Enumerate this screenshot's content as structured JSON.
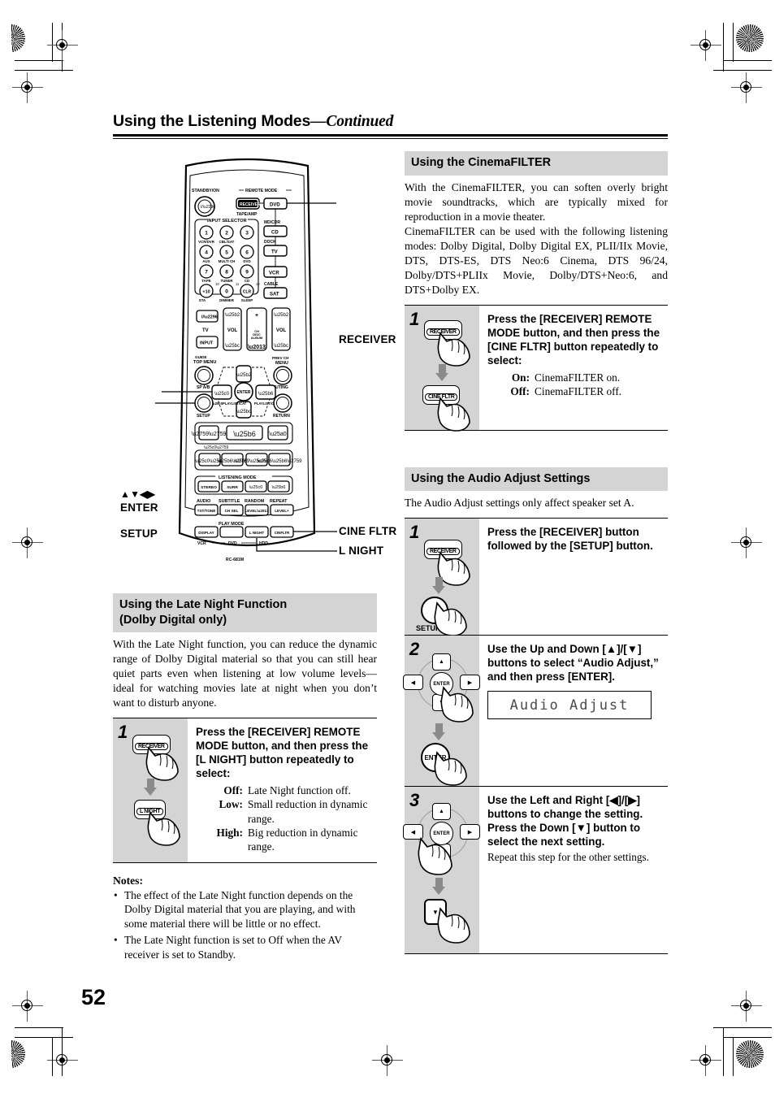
{
  "page": {
    "running_head_main": "Using the Listening Modes",
    "running_head_cont": "—Continued",
    "page_number": "52"
  },
  "remote": {
    "model": "RC-681M",
    "labels": {
      "standby": "STANDBY/ON",
      "remote_mode": "REMOTE MODE",
      "input_selector": "INPUT SELECTOR",
      "listening_mode": "LISTENING MODE",
      "play_mode": "PLAY MODE",
      "top_menu": "TOP MENU",
      "guide": "GUIDE",
      "menu": "MENU",
      "prev_ch": "PREV CH",
      "setup": "SETUP",
      "return": "RETURN",
      "muting": "MUTING",
      "sp_ab": "SP A/B",
      "tv": "TV",
      "vol": "VOL",
      "input": "INPUT",
      "dimmer": "DIMMER",
      "sleep": "SLEEP",
      "display": "DISPLAY",
      "audio": "AUDIO",
      "subtitle": "SUBTITLE",
      "random": "RANDOM",
      "repeat": "REPEAT",
      "vcr": "VCR",
      "dvd": "DVD",
      "hdd": "HDD",
      "tape_amp": "TAPE/AMP",
      "md_cdr": "MD/CDR",
      "dock": "DOCK",
      "cable": "CABLE"
    },
    "mode_keys": [
      "RECEIVER",
      "DVD",
      "CD",
      "TV",
      "VCR",
      "SAT"
    ],
    "input_keys": [
      {
        "num": "1",
        "sub": "VCR/DVR"
      },
      {
        "num": "2",
        "sub": "CBL/SAT"
      },
      {
        "num": "3",
        "sub": ""
      },
      {
        "num": "4",
        "sub": "AUX"
      },
      {
        "num": "5",
        "sub": "MULTI CH"
      },
      {
        "num": "6",
        "sub": "DVD"
      },
      {
        "num": "7",
        "sub": "TAPE"
      },
      {
        "num": "8",
        "sub": "TUNER"
      },
      {
        "num": "9",
        "sub": "CD"
      },
      {
        "num": "+10",
        "sub": ""
      },
      {
        "num": "0",
        "sub": "DIMMER"
      },
      {
        "num": "CLR",
        "sub": "SLEEP"
      }
    ],
    "listening_keys": [
      "STEREO",
      "SURR",
      "◀",
      "▶"
    ],
    "fn_keys": [
      "TST/TONE",
      "CH SEL",
      "LEVEL –",
      "LEVEL +"
    ],
    "play_keys": [
      "DISPLAY",
      "",
      "L NIGHT",
      "CINFLTR"
    ],
    "callouts": [
      {
        "id": "receiver",
        "text": "RECEIVER"
      },
      {
        "id": "arrows",
        "text": "▲▼◀▶"
      },
      {
        "id": "enter",
        "text": "ENTER"
      },
      {
        "id": "setup",
        "text": "SETUP"
      },
      {
        "id": "cine-fltr",
        "text": "CINE FLTR"
      },
      {
        "id": "l-night",
        "text": "L NIGHT"
      }
    ]
  },
  "cinemafilter": {
    "heading": "Using the CinemaFILTER",
    "intro_p1": "With the CinemaFILTER, you can soften overly bright movie soundtracks, which are typically mixed for reproduction in a movie theater.",
    "intro_p2": "CinemaFILTER can be used with the following listening modes: Dolby Digital, Dolby Digital EX, PLII/IIx Movie, DTS, DTS-ES, DTS Neo:6 Cinema, DTS 96/24, Dolby/DTS+PLIIx Movie, Dolby/DTS+Neo:6, and DTS+Dolby EX.",
    "step1": {
      "number": "1",
      "instruction": "Press the [RECEIVER] REMOTE MODE button, and then press the [CINE FLTR] button repeatedly to select:",
      "key_top": "RECEIVER",
      "key_bottom": "CINE FLTR",
      "options": [
        {
          "key": "On:",
          "value": "CinemaFILTER on."
        },
        {
          "key": "Off:",
          "value": "CinemaFILTER off."
        }
      ]
    }
  },
  "audio_adjust": {
    "heading": "Using the Audio Adjust Settings",
    "intro": "The Audio Adjust settings only affect speaker set A.",
    "steps": [
      {
        "number": "1",
        "instruction": "Press the [RECEIVER] button followed by the [SETUP] button.",
        "key_top": "RECEIVER",
        "key_bottom": "SETUP"
      },
      {
        "number": "2",
        "instruction": "Use the Up and Down [▲]/[▼] buttons to select “Audio Adjust,” and then press [ENTER].",
        "key_bottom": "ENTER",
        "display_text": "Audio Adjust"
      },
      {
        "number": "3",
        "instruction_a": "Use the Left and Right [◀]/[▶] buttons to change the setting.",
        "instruction_b": "Press the Down [▼] button to select the next setting.",
        "sub": "Repeat this step for the other settings."
      }
    ]
  },
  "late_night": {
    "heading_line1": "Using the Late Night Function",
    "heading_line2": "(Dolby Digital only)",
    "intro": "With the Late Night function, you can reduce the dynamic range of Dolby Digital material so that you can still hear quiet parts even when listening at low volume levels—ideal for watching movies late at night when you don’t want to disturb anyone.",
    "step1": {
      "number": "1",
      "instruction": "Press the [RECEIVER] REMOTE MODE button, and then press the [L NIGHT] button repeatedly to select:",
      "key_top": "RECEIVER",
      "key_bottom": "L NIGHT",
      "options": [
        {
          "key": "Off:",
          "value": "Late Night function off."
        },
        {
          "key": "Low:",
          "value": "Small reduction in dynamic range."
        },
        {
          "key": "High:",
          "value": "Big reduction in dynamic range."
        }
      ]
    },
    "notes_heading": "Notes:",
    "notes": [
      "The effect of the Late Night function depends on the Dolby Digital material that you are playing, and with some material there will be little or no effect.",
      "The Late Night function is set to Off when the AV receiver is set to Standby."
    ]
  },
  "colors": {
    "grey_bar": "#d4d4d4",
    "arrow_grey": "#8a8a8a",
    "rule": "#000000"
  }
}
